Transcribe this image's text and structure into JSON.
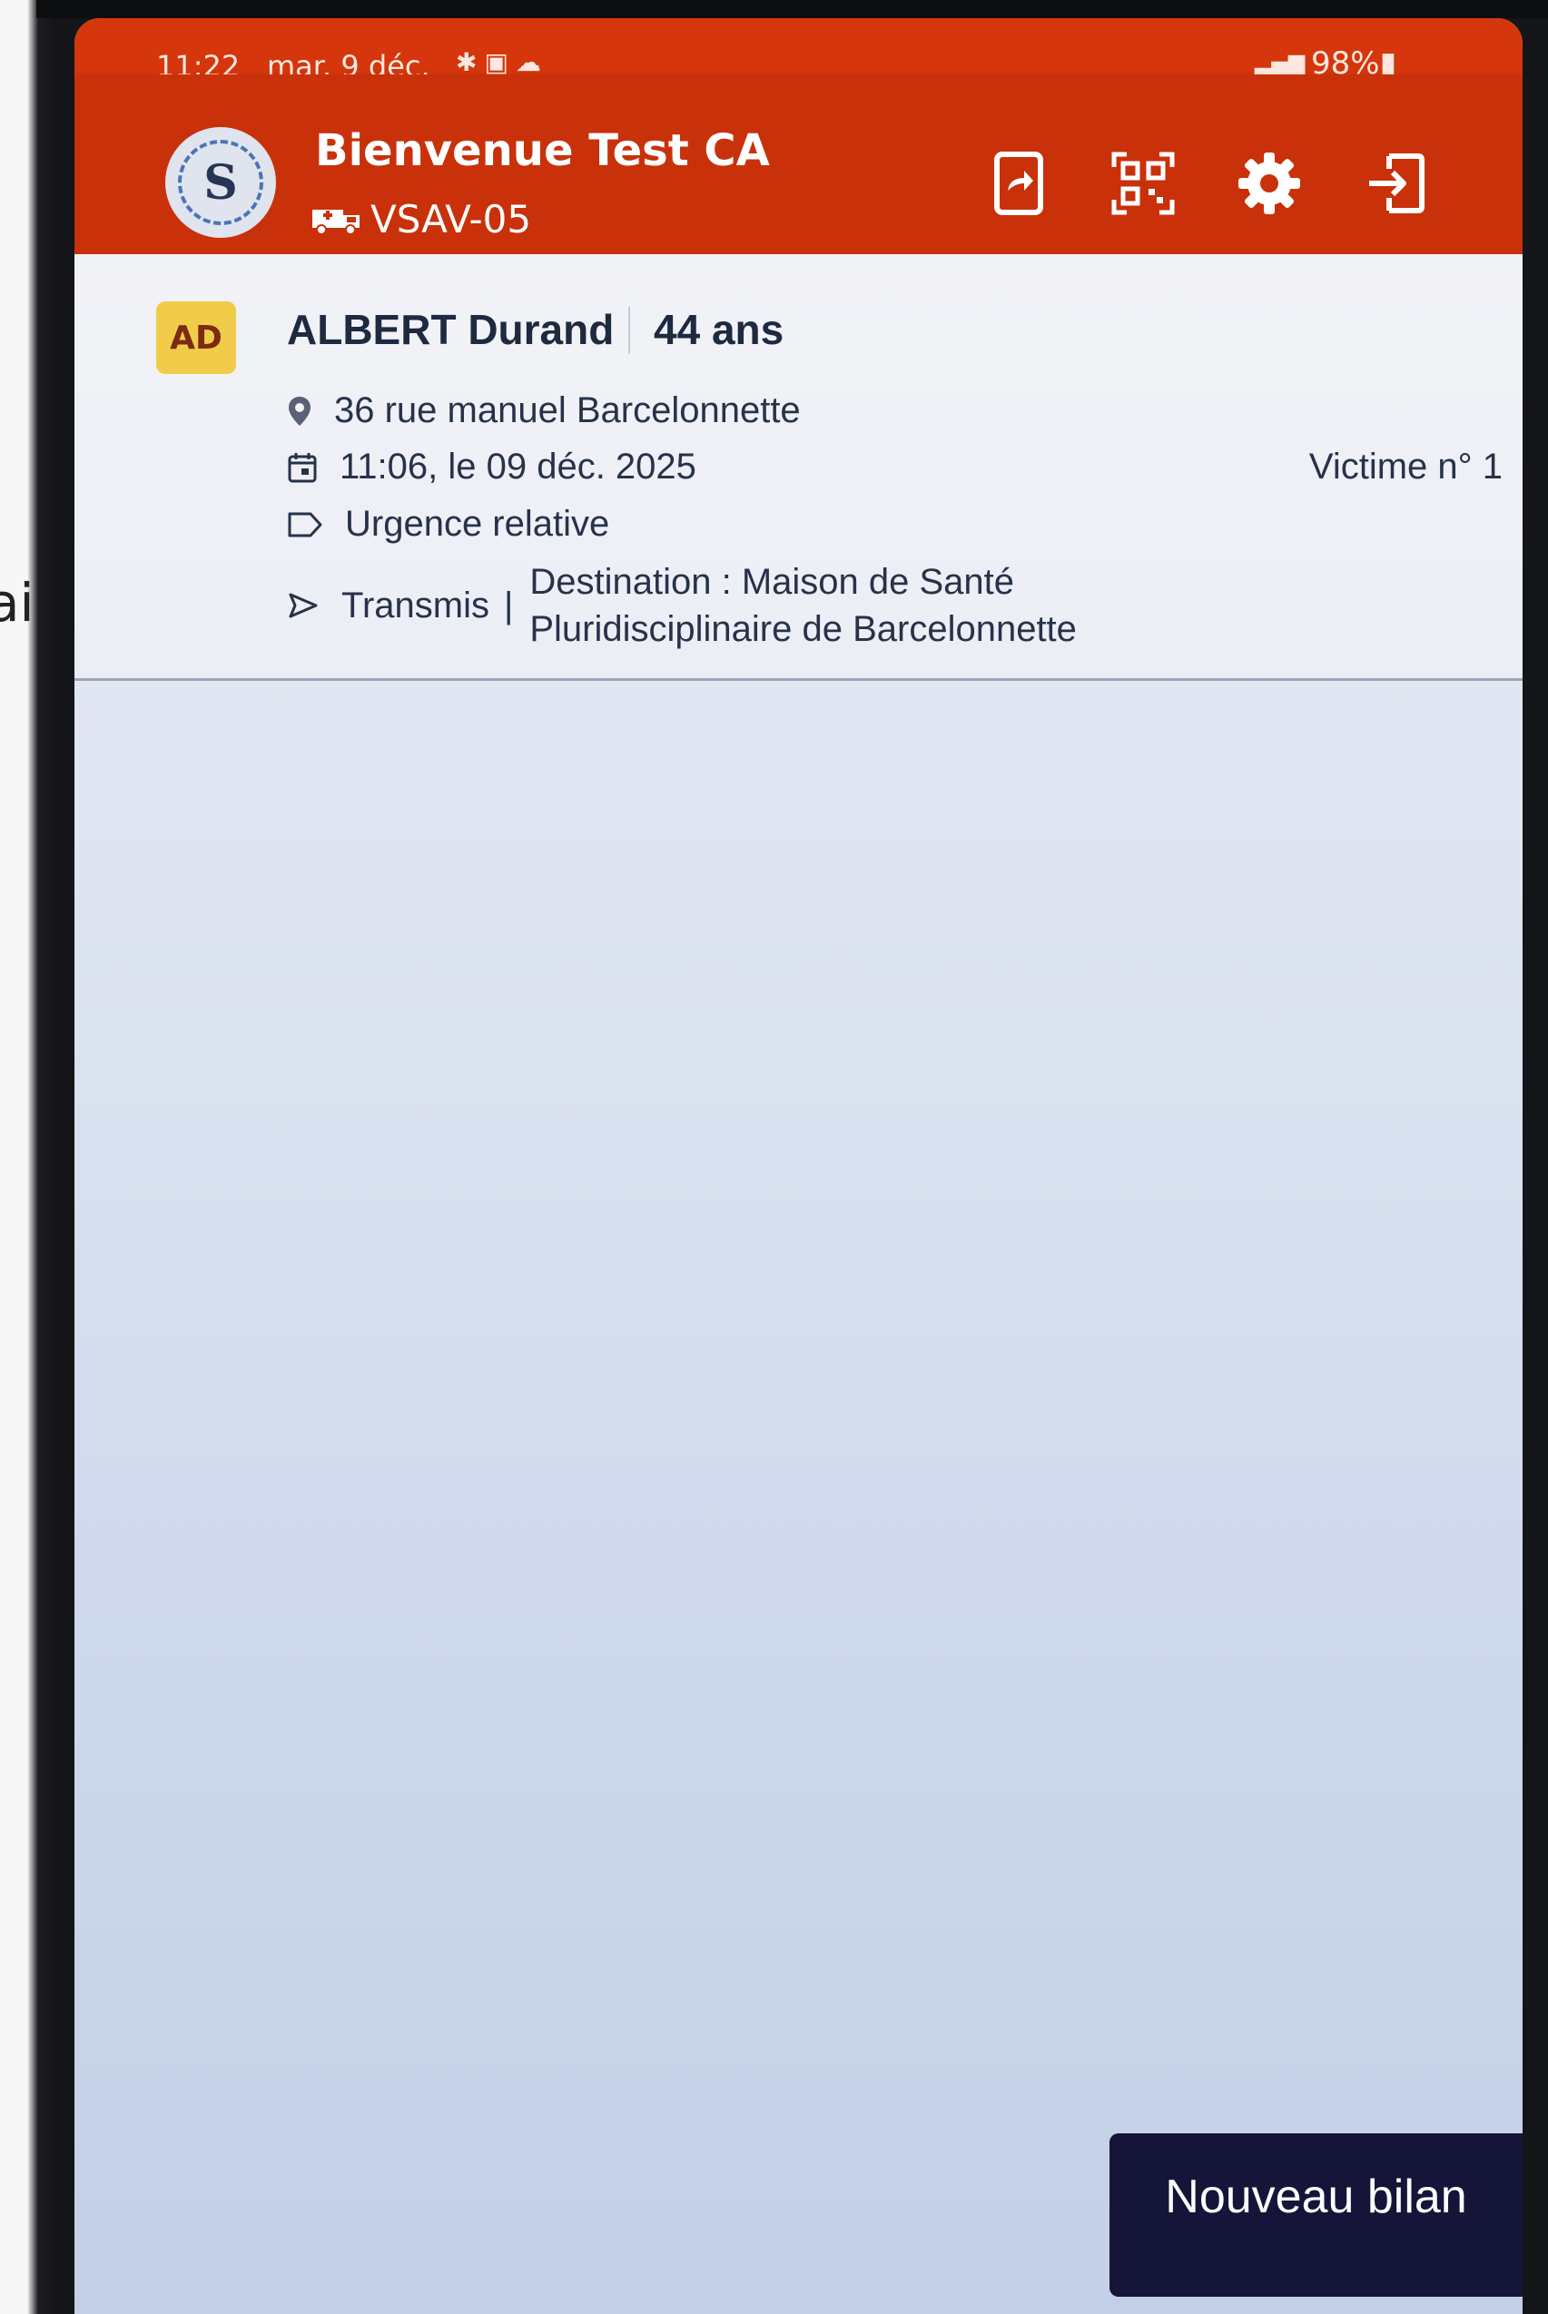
{
  "status_bar": {
    "time": "11:22",
    "date": "mar. 9 déc.",
    "notification_icons": [
      "bug-icon",
      "mail-icon",
      "cloud-icon"
    ],
    "battery": "98%"
  },
  "app_bar": {
    "avatar_letter": "S",
    "welcome": "Bienvenue Test CA",
    "vehicle": "VSAV-05",
    "actions": [
      "share-screen-icon",
      "qr-code-icon",
      "gear-icon",
      "logout-icon"
    ],
    "color": "#c9310b"
  },
  "victim": {
    "initials": "AD",
    "name": "ALBERT Durand",
    "age": "44 ans",
    "address": "36 rue manuel Barcelonnette",
    "datetime": "11:06, le 09 déc. 2025",
    "victim_number": "Victime n° 1",
    "urgency": "Urgence relative",
    "status": "Transmis",
    "separator": "|",
    "destination_line1": "Destination : Maison de Santé",
    "destination_line2": "Pluridisciplinaire de Barcelonnette"
  },
  "fab": {
    "label": "Nouveau bilan",
    "color": "#15153a"
  },
  "background_fragment": "ai"
}
